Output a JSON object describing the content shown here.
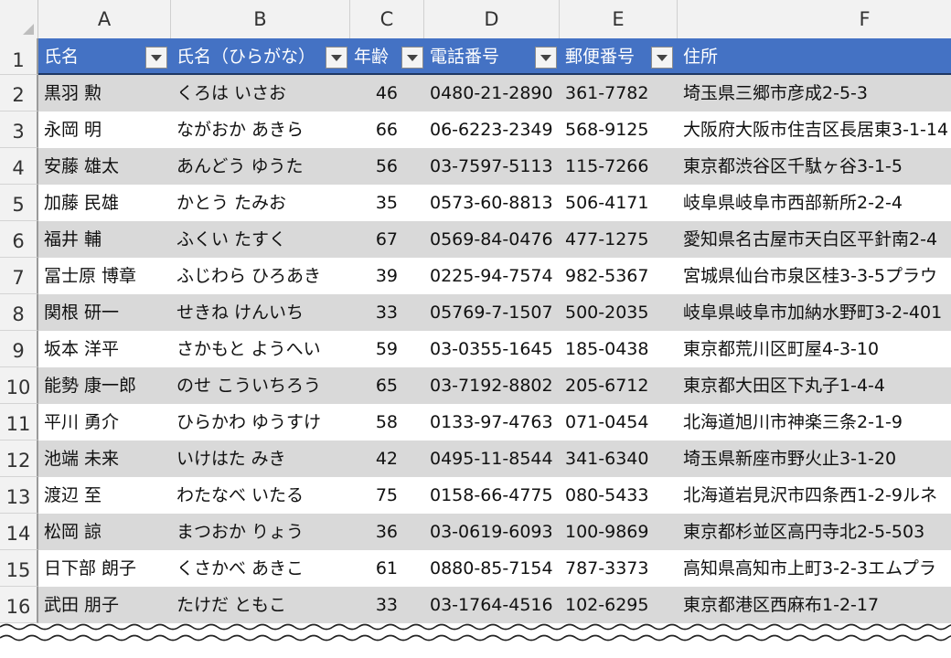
{
  "column_letters": [
    "A",
    "B",
    "C",
    "D",
    "E",
    "F"
  ],
  "header_row_number": "1",
  "headers": {
    "name": "氏名",
    "kana": "氏名（ひらがな）",
    "age": "年齢",
    "phone": "電話番号",
    "postal": "郵便番号",
    "address": "住所"
  },
  "rows": [
    {
      "num": "2",
      "name": "黒羽 勲",
      "kana": "くろは いさお",
      "age": "46",
      "phone": "0480-21-2890",
      "postal": "361-7782",
      "address": "埼玉県三郷市彦成2-5-3"
    },
    {
      "num": "3",
      "name": "永岡 明",
      "kana": "ながおか あきら",
      "age": "66",
      "phone": "06-6223-2349",
      "postal": "568-9125",
      "address": "大阪府大阪市住吉区長居東3-1-14"
    },
    {
      "num": "4",
      "name": "安藤 雄太",
      "kana": "あんどう ゆうた",
      "age": "56",
      "phone": "03-7597-5113",
      "postal": "115-7266",
      "address": "東京都渋谷区千駄ヶ谷3-1-5"
    },
    {
      "num": "5",
      "name": "加藤 民雄",
      "kana": "かとう たみお",
      "age": "35",
      "phone": "0573-60-8813",
      "postal": "506-4171",
      "address": "岐阜県岐阜市西部新所2-2-4"
    },
    {
      "num": "6",
      "name": "福井 輔",
      "kana": "ふくい たすく",
      "age": "67",
      "phone": "0569-84-0476",
      "postal": "477-1275",
      "address": "愛知県名古屋市天白区平針南2-4"
    },
    {
      "num": "7",
      "name": "冨士原 博章",
      "kana": "ふじわら ひろあき",
      "age": "39",
      "phone": "0225-94-7574",
      "postal": "982-5367",
      "address": "宮城県仙台市泉区桂3-3-5プラウ"
    },
    {
      "num": "8",
      "name": "関根 研一",
      "kana": "せきね けんいち",
      "age": "33",
      "phone": "05769-7-1507",
      "postal": "500-2035",
      "address": "岐阜県岐阜市加納水野町3-2-401"
    },
    {
      "num": "9",
      "name": "坂本 洋平",
      "kana": "さかもと ようへい",
      "age": "59",
      "phone": "03-0355-1645",
      "postal": "185-0438",
      "address": "東京都荒川区町屋4-3-10"
    },
    {
      "num": "10",
      "name": "能勢 康一郎",
      "kana": "のせ こういちろう",
      "age": "65",
      "phone": "03-7192-8802",
      "postal": "205-6712",
      "address": "東京都大田区下丸子1-4-4"
    },
    {
      "num": "11",
      "name": "平川 勇介",
      "kana": "ひらかわ ゆうすけ",
      "age": "58",
      "phone": "0133-97-4763",
      "postal": "071-0454",
      "address": "北海道旭川市神楽三条2-1-9"
    },
    {
      "num": "12",
      "name": "池端 未来",
      "kana": "いけはた みき",
      "age": "42",
      "phone": "0495-11-8544",
      "postal": "341-6340",
      "address": "埼玉県新座市野火止3-1-20"
    },
    {
      "num": "13",
      "name": "渡辺 至",
      "kana": "わたなべ いたる",
      "age": "75",
      "phone": "0158-66-4775",
      "postal": "080-5433",
      "address": "北海道岩見沢市四条西1-2-9ルネ"
    },
    {
      "num": "14",
      "name": "松岡 諒",
      "kana": "まつおか りょう",
      "age": "36",
      "phone": "03-0619-6093",
      "postal": "100-9869",
      "address": "東京都杉並区高円寺北2-5-503"
    },
    {
      "num": "15",
      "name": "日下部 朗子",
      "kana": "くさかべ あきこ",
      "age": "61",
      "phone": "0880-85-7154",
      "postal": "787-3373",
      "address": "高知県高知市上町3-2-3エムプラ"
    },
    {
      "num": "16",
      "name": "武田 朋子",
      "kana": "たけだ ともこ",
      "age": "33",
      "phone": "03-1764-4516",
      "postal": "102-6295",
      "address": "東京都港区西麻布1-2-17"
    }
  ],
  "colors": {
    "header_bg": "#4472c4",
    "header_text": "#ffffff",
    "band_row": "#d9d9d9",
    "plain_row": "#ffffff",
    "grid_header": "#f2f2f2"
  }
}
